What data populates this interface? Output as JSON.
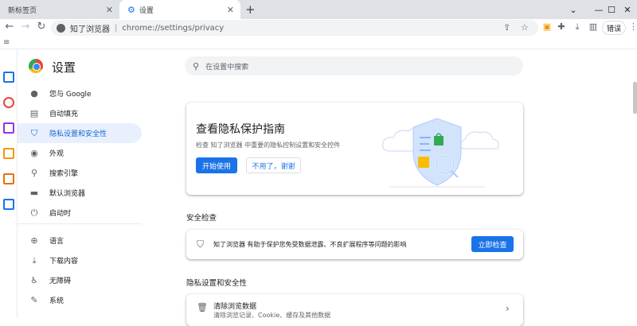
{
  "tabs": [
    {
      "title": "新标签页",
      "close": "✕"
    },
    {
      "title": "设置",
      "close": "✕"
    }
  ],
  "new_tab": "+",
  "window_controls": {
    "minimize": "—",
    "maximize": "☐",
    "close": "✕"
  },
  "toolbar": {
    "back": "←",
    "forward": "→",
    "reload": "↻",
    "chip_label": "知了浏览器",
    "separator": "|",
    "url": "chrome://settings/privacy",
    "share": "⇪",
    "bookmark_star": "☆",
    "error_button": "错误",
    "menu": "⋮"
  },
  "sidebar": {
    "title": "设置",
    "items": [
      {
        "label": "您与 Google",
        "icon": "person-icon"
      },
      {
        "label": "自动填充",
        "icon": "clipboard-icon"
      },
      {
        "label": "隐私设置和安全性",
        "icon": "shield-icon",
        "selected": true
      },
      {
        "label": "外观",
        "icon": "palette-icon"
      },
      {
        "label": "搜索引擎",
        "icon": "search-icon"
      },
      {
        "label": "默认浏览器",
        "icon": "browser-icon"
      },
      {
        "label": "启动时",
        "icon": "power-icon"
      },
      {
        "label": "语言",
        "icon": "globe-icon"
      },
      {
        "label": "下载内容",
        "icon": "download-icon"
      },
      {
        "label": "无障碍",
        "icon": "accessibility-icon"
      },
      {
        "label": "系统",
        "icon": "wrench-icon"
      }
    ]
  },
  "search": {
    "placeholder": "在设置中搜索"
  },
  "privacy_guide": {
    "title": "查看隐私保护指南",
    "description": "检查 知了浏览器 中重要的隐私控制设置和安全控件",
    "start": "开始使用",
    "decline": "不用了，谢谢"
  },
  "safety_check": {
    "heading": "安全检查",
    "text": "知了浏览器 有助于保护您免受数据泄露、不良扩展程序等问题的影响",
    "button": "立即检查"
  },
  "privacy_section": {
    "heading": "隐私设置和安全性",
    "clear_title": "清除浏览数据",
    "clear_sub": "清除浏览记录、Cookie、缓存及其他数据",
    "arrow": "›"
  },
  "colors": {
    "accent": "#1a73e8",
    "selected_bg": "#e8f0fe"
  }
}
